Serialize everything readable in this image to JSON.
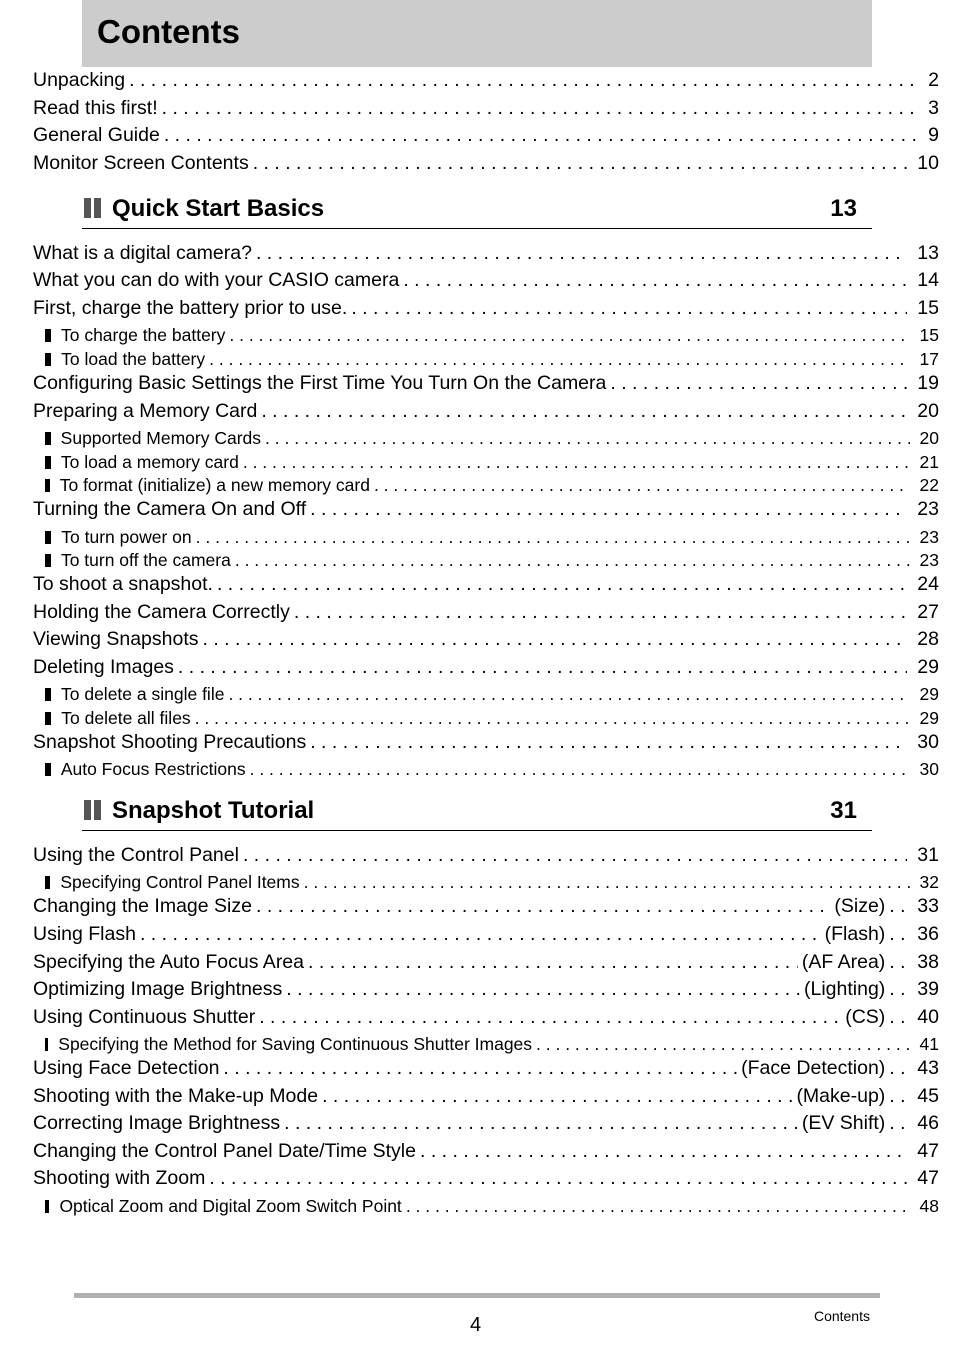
{
  "header": {
    "title": "Contents"
  },
  "intro": [
    {
      "title": "Unpacking",
      "page": "2"
    },
    {
      "title": "Read this first!",
      "page": "3"
    },
    {
      "title": "General Guide",
      "page": "9"
    },
    {
      "title": "Monitor Screen Contents",
      "page": "10"
    }
  ],
  "sections": [
    {
      "title": "Quick Start Basics",
      "page": "13",
      "entries": [
        {
          "title": "What is a digital camera?",
          "page": "13",
          "level": 1
        },
        {
          "title": "What you can do with your CASIO camera",
          "page": "14",
          "level": 1
        },
        {
          "title": "First, charge the battery prior to use.",
          "page": "15",
          "level": 1
        },
        {
          "title": "To charge the battery",
          "page": "15",
          "level": 2
        },
        {
          "title": "To load the battery",
          "page": "17",
          "level": 2
        },
        {
          "title": "Configuring Basic Settings the First Time You Turn On the Camera",
          "page": "19",
          "level": 1
        },
        {
          "title": "Preparing a Memory Card",
          "page": "20",
          "level": 1
        },
        {
          "title": "Supported Memory Cards",
          "page": "20",
          "level": 2
        },
        {
          "title": "To load a memory card",
          "page": "21",
          "level": 2
        },
        {
          "title": "To format (initialize) a new memory card",
          "page": "22",
          "level": 2
        },
        {
          "title": "Turning the Camera On and Off",
          "page": "23",
          "level": 1
        },
        {
          "title": "To turn power on",
          "page": "23",
          "level": 2
        },
        {
          "title": "To turn off the camera",
          "page": "23",
          "level": 2
        },
        {
          "title": "To shoot a snapshot.",
          "page": "24",
          "level": 1
        },
        {
          "title": "Holding the Camera Correctly",
          "page": "27",
          "level": 1
        },
        {
          "title": "Viewing Snapshots",
          "page": "28",
          "level": 1
        },
        {
          "title": "Deleting Images",
          "page": "29",
          "level": 1
        },
        {
          "title": "To delete a single file",
          "page": "29",
          "level": 2
        },
        {
          "title": "To delete all files",
          "page": "29",
          "level": 2
        },
        {
          "title": "Snapshot Shooting Precautions",
          "page": "30",
          "level": 1
        },
        {
          "title": "Auto Focus Restrictions",
          "page": "30",
          "level": 2
        }
      ]
    },
    {
      "title": "Snapshot Tutorial",
      "page": "31",
      "entries": [
        {
          "title": "Using the Control Panel",
          "page": "31",
          "level": 1
        },
        {
          "title": "Specifying Control Panel Items",
          "page": "32",
          "level": 2
        },
        {
          "title": "Changing the Image Size",
          "key": "(Size)",
          "page": "33",
          "level": 1
        },
        {
          "title": "Using Flash",
          "key": "(Flash)",
          "page": "36",
          "level": 1
        },
        {
          "title": "Specifying the Auto Focus Area",
          "key": "(AF Area)",
          "page": "38",
          "level": 1
        },
        {
          "title": "Optimizing Image Brightness",
          "key": "(Lighting)",
          "page": "39",
          "level": 1
        },
        {
          "title": "Using Continuous Shutter",
          "key": "(CS)",
          "page": "40",
          "level": 1
        },
        {
          "title": "Specifying the Method for Saving Continuous Shutter Images",
          "page": "41",
          "level": 2
        },
        {
          "title": "Using Face Detection",
          "key": "(Face Detection)",
          "page": "43",
          "level": 1
        },
        {
          "title": "Shooting with the Make-up Mode",
          "key": "(Make-up)",
          "page": "45",
          "level": 1
        },
        {
          "title": "Correcting Image Brightness",
          "key": "(EV Shift)",
          "page": "46",
          "level": 1
        },
        {
          "title": "Changing the Control Panel Date/Time Style",
          "page": "47",
          "level": 1
        },
        {
          "title": "Shooting with Zoom",
          "page": "47",
          "level": 1
        },
        {
          "title": "Optical Zoom and Digital Zoom Switch Point",
          "page": "48",
          "level": 2
        }
      ]
    }
  ],
  "footer": {
    "page_number": "4",
    "label": "Contents"
  }
}
